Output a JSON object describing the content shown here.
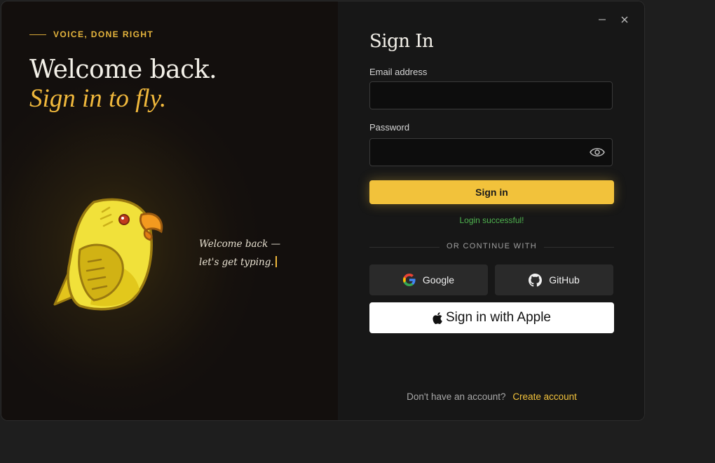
{
  "hero": {
    "eyebrow": "VOICE, DONE RIGHT",
    "headline": "Welcome back.",
    "subhead": "Sign in to fly.",
    "tagline_line1": "Welcome back —",
    "tagline_line2": "let's get typing."
  },
  "window_controls": {
    "minimize": "–",
    "close": "✕"
  },
  "form": {
    "title": "Sign In",
    "email_label": "Email address",
    "email_value": "",
    "password_label": "Password",
    "password_value": "",
    "submit_label": "Sign in",
    "status_message": "Login successful!",
    "divider_text": "OR CONTINUE WITH",
    "google_label": "Google",
    "github_label": "GitHub",
    "apple_label": "Sign in with Apple"
  },
  "footer": {
    "question": "Don't have an account?",
    "link": "Create account"
  },
  "colors": {
    "accent": "#f2c23b",
    "success": "#4fb34f",
    "background": "#171717"
  },
  "icons": [
    "parrot-mascot",
    "minimize-icon",
    "close-icon",
    "eye-icon",
    "google-icon",
    "github-icon",
    "apple-icon"
  ]
}
